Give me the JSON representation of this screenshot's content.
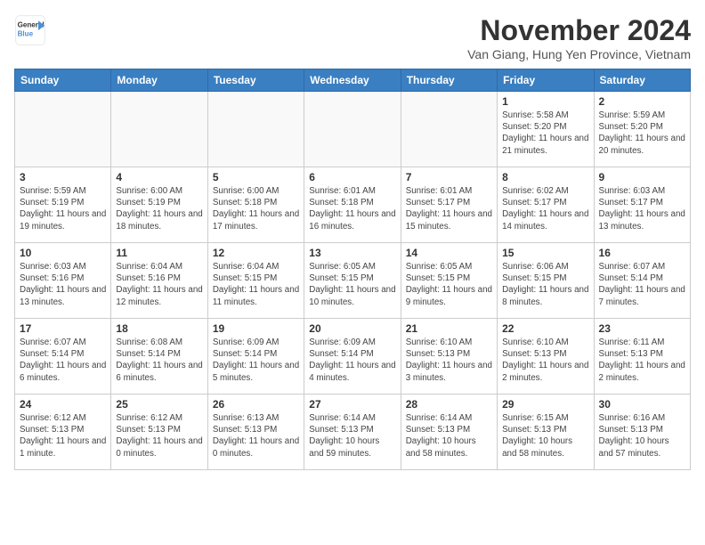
{
  "header": {
    "logo_line1": "General",
    "logo_line2": "Blue",
    "month": "November 2024",
    "location": "Van Giang, Hung Yen Province, Vietnam"
  },
  "weekdays": [
    "Sunday",
    "Monday",
    "Tuesday",
    "Wednesday",
    "Thursday",
    "Friday",
    "Saturday"
  ],
  "weeks": [
    [
      {
        "day": "",
        "info": ""
      },
      {
        "day": "",
        "info": ""
      },
      {
        "day": "",
        "info": ""
      },
      {
        "day": "",
        "info": ""
      },
      {
        "day": "",
        "info": ""
      },
      {
        "day": "1",
        "info": "Sunrise: 5:58 AM\nSunset: 5:20 PM\nDaylight: 11 hours and 21 minutes."
      },
      {
        "day": "2",
        "info": "Sunrise: 5:59 AM\nSunset: 5:20 PM\nDaylight: 11 hours and 20 minutes."
      }
    ],
    [
      {
        "day": "3",
        "info": "Sunrise: 5:59 AM\nSunset: 5:19 PM\nDaylight: 11 hours and 19 minutes."
      },
      {
        "day": "4",
        "info": "Sunrise: 6:00 AM\nSunset: 5:19 PM\nDaylight: 11 hours and 18 minutes."
      },
      {
        "day": "5",
        "info": "Sunrise: 6:00 AM\nSunset: 5:18 PM\nDaylight: 11 hours and 17 minutes."
      },
      {
        "day": "6",
        "info": "Sunrise: 6:01 AM\nSunset: 5:18 PM\nDaylight: 11 hours and 16 minutes."
      },
      {
        "day": "7",
        "info": "Sunrise: 6:01 AM\nSunset: 5:17 PM\nDaylight: 11 hours and 15 minutes."
      },
      {
        "day": "8",
        "info": "Sunrise: 6:02 AM\nSunset: 5:17 PM\nDaylight: 11 hours and 14 minutes."
      },
      {
        "day": "9",
        "info": "Sunrise: 6:03 AM\nSunset: 5:17 PM\nDaylight: 11 hours and 13 minutes."
      }
    ],
    [
      {
        "day": "10",
        "info": "Sunrise: 6:03 AM\nSunset: 5:16 PM\nDaylight: 11 hours and 13 minutes."
      },
      {
        "day": "11",
        "info": "Sunrise: 6:04 AM\nSunset: 5:16 PM\nDaylight: 11 hours and 12 minutes."
      },
      {
        "day": "12",
        "info": "Sunrise: 6:04 AM\nSunset: 5:15 PM\nDaylight: 11 hours and 11 minutes."
      },
      {
        "day": "13",
        "info": "Sunrise: 6:05 AM\nSunset: 5:15 PM\nDaylight: 11 hours and 10 minutes."
      },
      {
        "day": "14",
        "info": "Sunrise: 6:05 AM\nSunset: 5:15 PM\nDaylight: 11 hours and 9 minutes."
      },
      {
        "day": "15",
        "info": "Sunrise: 6:06 AM\nSunset: 5:15 PM\nDaylight: 11 hours and 8 minutes."
      },
      {
        "day": "16",
        "info": "Sunrise: 6:07 AM\nSunset: 5:14 PM\nDaylight: 11 hours and 7 minutes."
      }
    ],
    [
      {
        "day": "17",
        "info": "Sunrise: 6:07 AM\nSunset: 5:14 PM\nDaylight: 11 hours and 6 minutes."
      },
      {
        "day": "18",
        "info": "Sunrise: 6:08 AM\nSunset: 5:14 PM\nDaylight: 11 hours and 6 minutes."
      },
      {
        "day": "19",
        "info": "Sunrise: 6:09 AM\nSunset: 5:14 PM\nDaylight: 11 hours and 5 minutes."
      },
      {
        "day": "20",
        "info": "Sunrise: 6:09 AM\nSunset: 5:14 PM\nDaylight: 11 hours and 4 minutes."
      },
      {
        "day": "21",
        "info": "Sunrise: 6:10 AM\nSunset: 5:13 PM\nDaylight: 11 hours and 3 minutes."
      },
      {
        "day": "22",
        "info": "Sunrise: 6:10 AM\nSunset: 5:13 PM\nDaylight: 11 hours and 2 minutes."
      },
      {
        "day": "23",
        "info": "Sunrise: 6:11 AM\nSunset: 5:13 PM\nDaylight: 11 hours and 2 minutes."
      }
    ],
    [
      {
        "day": "24",
        "info": "Sunrise: 6:12 AM\nSunset: 5:13 PM\nDaylight: 11 hours and 1 minute."
      },
      {
        "day": "25",
        "info": "Sunrise: 6:12 AM\nSunset: 5:13 PM\nDaylight: 11 hours and 0 minutes."
      },
      {
        "day": "26",
        "info": "Sunrise: 6:13 AM\nSunset: 5:13 PM\nDaylight: 11 hours and 0 minutes."
      },
      {
        "day": "27",
        "info": "Sunrise: 6:14 AM\nSunset: 5:13 PM\nDaylight: 10 hours and 59 minutes."
      },
      {
        "day": "28",
        "info": "Sunrise: 6:14 AM\nSunset: 5:13 PM\nDaylight: 10 hours and 58 minutes."
      },
      {
        "day": "29",
        "info": "Sunrise: 6:15 AM\nSunset: 5:13 PM\nDaylight: 10 hours and 58 minutes."
      },
      {
        "day": "30",
        "info": "Sunrise: 6:16 AM\nSunset: 5:13 PM\nDaylight: 10 hours and 57 minutes."
      }
    ]
  ]
}
